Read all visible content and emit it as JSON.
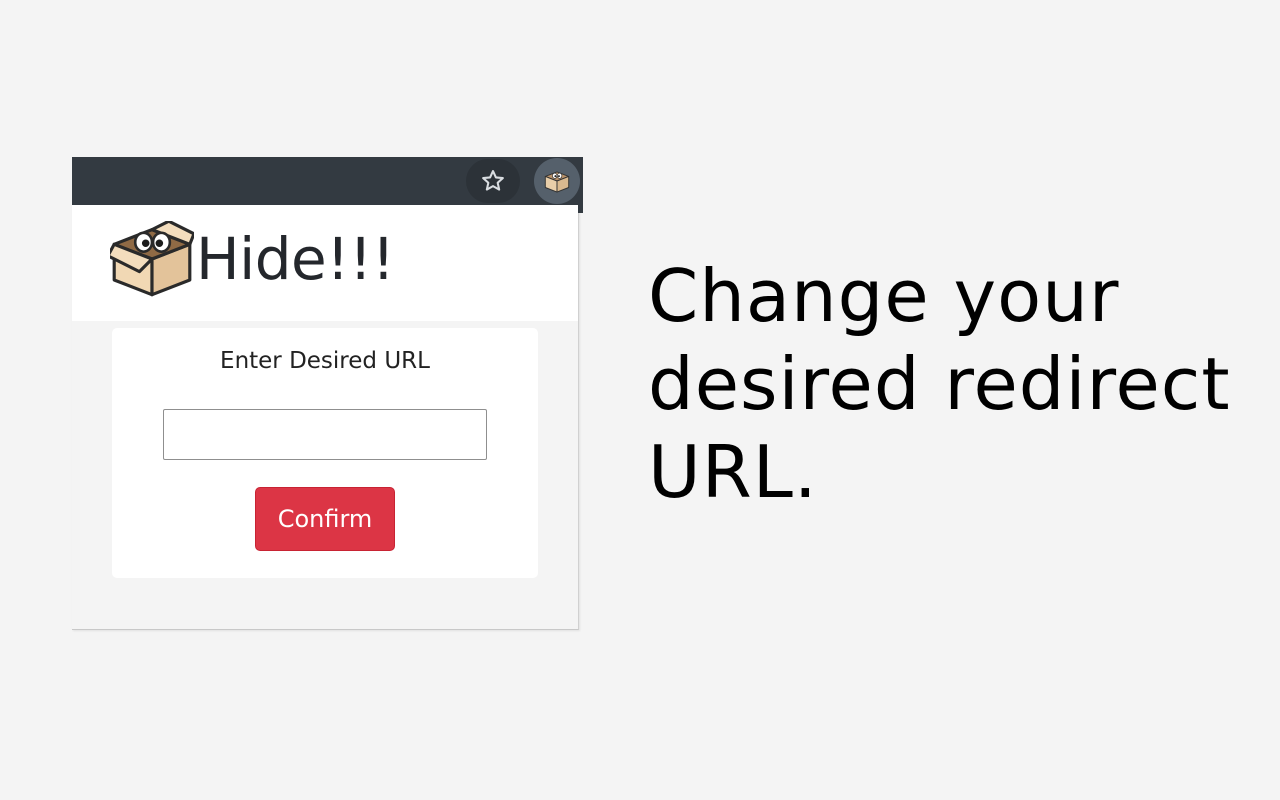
{
  "browser_toolbar": {
    "bookmark_icon": "star-outline-icon",
    "extension_icon": "cardboard-box-mascot-icon"
  },
  "popup": {
    "brand": {
      "logo": "cardboard-box-mascot-icon",
      "title": "Hide!!!"
    },
    "form": {
      "label": "Enter Desired URL",
      "url_value": "",
      "url_placeholder": "",
      "confirm_label": "Confirm"
    }
  },
  "promo": {
    "headline": "Change your desired redirect URL."
  },
  "colors": {
    "toolbar_bg": "#333a41",
    "confirm_bg": "#dc3545",
    "page_bg": "#f4f4f4"
  }
}
